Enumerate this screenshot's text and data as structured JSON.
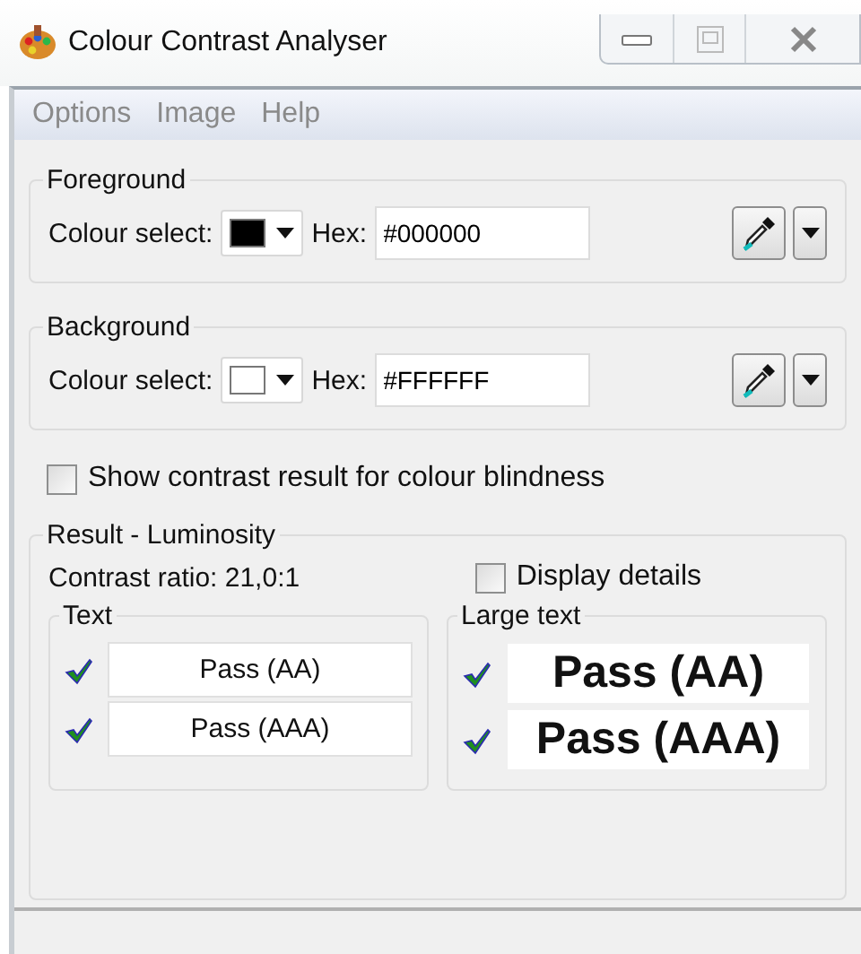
{
  "window": {
    "title": "Colour Contrast Analyser"
  },
  "menu": [
    "Options",
    "Image",
    "Help"
  ],
  "colour_groups": [
    {
      "title": "Foreground",
      "select_label": "Colour select:",
      "color": "#000000",
      "hex_label": "Hex:",
      "hex_value": "#000000"
    },
    {
      "title": "Background",
      "select_label": "Colour select:",
      "color": "#ffffff",
      "hex_label": "Hex:",
      "hex_value": "#FFFFFF"
    }
  ],
  "colour_blindness": {
    "label": "Show contrast result for colour blindness",
    "checked": false
  },
  "result": {
    "title": "Result - Luminosity",
    "contrast_ratio": "Contrast ratio: 21,0:1",
    "details": {
      "label": "Display details",
      "checked": false
    },
    "groups": [
      {
        "title": "Text",
        "kind": "normal",
        "items": [
          {
            "label": "Pass (AA)",
            "passed": true
          },
          {
            "label": "Pass (AAA)",
            "passed": true
          }
        ]
      },
      {
        "title": "Large text",
        "kind": "large",
        "items": [
          {
            "label": "Pass (AA)",
            "passed": true
          },
          {
            "label": "Pass (AAA)",
            "passed": true
          }
        ]
      }
    ]
  }
}
